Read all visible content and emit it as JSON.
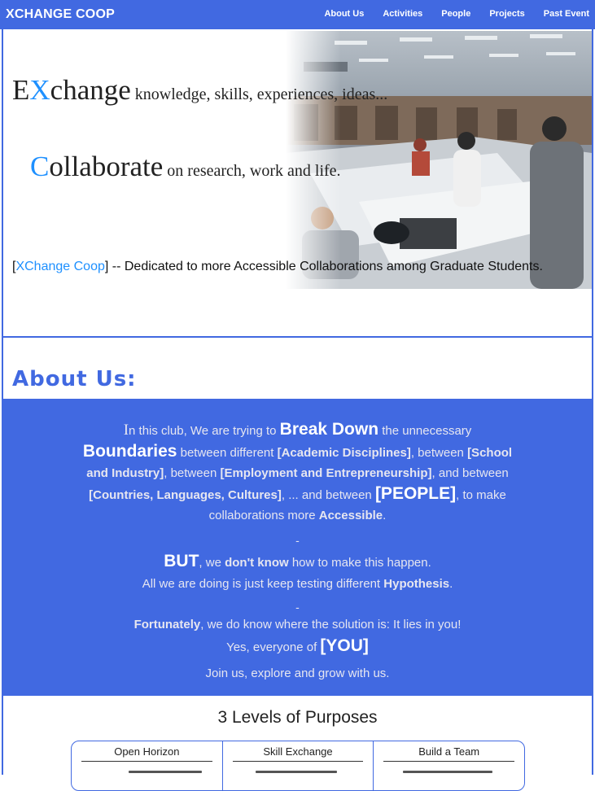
{
  "nav": {
    "brand": "XCHANGE COOP",
    "links": [
      "About Us",
      "Activities",
      "People",
      "Projects",
      "Past Event"
    ]
  },
  "hero": {
    "line1": {
      "e": "E",
      "x": "X",
      "change": "change",
      "rest": " knowledge, skills, experiences, ideas..."
    },
    "line2": {
      "c": "C",
      "ollaborate": "ollaborate",
      "rest": " on research, work and life."
    },
    "tagline": {
      "open": "[",
      "link": "XChange Coop",
      "close": "] -- Dedicated to more Accessible Collaborations among Graduate Students."
    }
  },
  "about": {
    "title": "About Us:",
    "p1": {
      "i": "I",
      "a": "n this club, We are trying to ",
      "break": "Break Down",
      "b": " the unnecessary",
      "boundaries": "Boundaries",
      "c": " between different ",
      "academic": "[Academic Disciplines]",
      "d": ", between ",
      "school": "[School and Industry]",
      "e": ", between ",
      "employment": "[Employment and Entrepreneurship]",
      "f": ", and between ",
      "countries": "[Countries, Languages, Cultures]",
      "g": ", ... and between ",
      "people": "[PEOPLE]",
      "h": ", to make collaborations more ",
      "accessible": "Accessible",
      "j": "."
    },
    "dash1": "-",
    "p2": {
      "but": "BUT",
      "a": ", we ",
      "dont": "don't know",
      "b": " how to make this happen."
    },
    "p3": {
      "a": "All we are doing is just keep testing different ",
      "hyp": "Hypothesis",
      "b": "."
    },
    "dash2": "-",
    "p4": {
      "fort": "Fortunately",
      "a": ", we do know where the solution is: It lies in you!"
    },
    "p5": {
      "a": "Yes, everyone of ",
      "you": "[YOU]"
    },
    "p6": "Join us, explore and grow with us."
  },
  "purposes": {
    "title": "3 Levels of Purposes",
    "cards": [
      "Open Horizon",
      "Skill Exchange",
      "Build a Team"
    ]
  },
  "colors": {
    "accent": "#4169e1",
    "link": "#1e90ff"
  }
}
